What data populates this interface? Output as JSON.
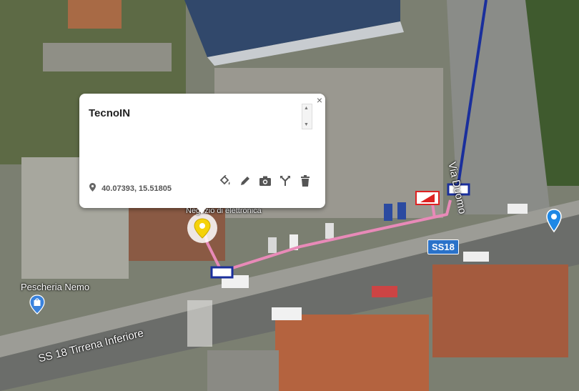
{
  "map": {
    "labels": {
      "poi_shop": "Negozio di elettronica",
      "poi_fish": "Pescheria Nemo",
      "road_duomo": "Via Duomo",
      "road_ss18": "SS 18 Tirrena Inferiore",
      "shield_ss18": "SS18"
    }
  },
  "popup": {
    "title": "TecnoIN",
    "coordinates": "40.07393, 15.51805",
    "close_label": "×"
  },
  "colors": {
    "route_pink": "#e88ab8",
    "route_blue": "#1a2f9c",
    "pin_yellow": "#f5d20a",
    "pin_blue": "#1e88e5",
    "shield_blue": "#2a72c9"
  }
}
